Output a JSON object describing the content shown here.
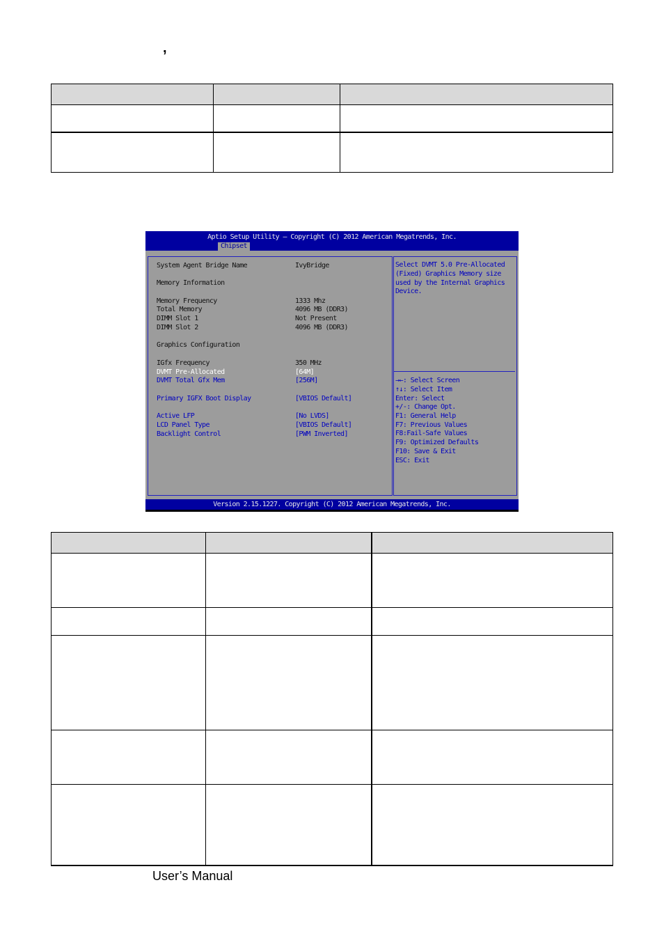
{
  "page": {
    "top_mark": ",",
    "footer": "User’s Manual"
  },
  "table_top": {
    "rows": 3,
    "columns": 3,
    "cells": [
      [
        "",
        "",
        ""
      ],
      [
        "",
        "",
        ""
      ],
      [
        "",
        "",
        ""
      ]
    ]
  },
  "table_bottom": {
    "rows": 6,
    "columns": 3,
    "cells": [
      [
        "",
        "",
        ""
      ],
      [
        "",
        "",
        ""
      ],
      [
        "",
        "",
        ""
      ],
      [
        "",
        "",
        ""
      ],
      [
        "",
        "",
        ""
      ],
      [
        "",
        "",
        ""
      ]
    ]
  },
  "bios": {
    "title": "Aptio Setup Utility – Copyright (C) 2012 American Megatrends, Inc.",
    "active_tab": "Chipset",
    "version": "Version 2.15.1227. Copyright (C) 2012 American Megatrends, Inc.",
    "colors": {
      "header_blue": "#0000a0",
      "panel_gray": "#9c9c9c",
      "link_blue": "#0000c0",
      "selected": "#ffffff"
    },
    "items": [
      {
        "label": "System Agent Bridge Name",
        "value": "IvyBridge",
        "type": "info"
      },
      {
        "label": "Memory Information",
        "value": "",
        "type": "heading"
      },
      {
        "label": "Memory Frequency",
        "value": "1333 Mhz",
        "type": "info"
      },
      {
        "label": "Total Memory",
        "value": "4096 MB (DDR3)",
        "type": "info"
      },
      {
        "label": "DIMM Slot 1",
        "value": "Not Present",
        "type": "info"
      },
      {
        "label": "DIMM Slot 2",
        "value": "4096 MB (DDR3)",
        "type": "info"
      },
      {
        "label": "Graphics Configuration",
        "value": "",
        "type": "heading"
      },
      {
        "label": "IGfx Frequency",
        "value": "350 MHz",
        "type": "info"
      },
      {
        "label": "DVMT Pre-Allocated",
        "value": "[64M]",
        "type": "option",
        "selected": true
      },
      {
        "label": "DVMT Total Gfx Mem",
        "value": "[256M]",
        "type": "option"
      },
      {
        "label": "Primary IGFX Boot Display",
        "value": "[VBIOS Default]",
        "type": "option"
      },
      {
        "label": "Active LFP",
        "value": "[No LVDS]",
        "type": "option"
      },
      {
        "label": "LCD Panel Type",
        "value": "[VBIOS Default]",
        "type": "option"
      },
      {
        "label": "Backlight Control",
        "value": "[PWM Inverted]",
        "type": "option"
      }
    ],
    "help_text": "Select DVMT 5.0 Pre-Allocated\n(Fixed) Graphics Memory size\nused by the Internal Graphics\nDevice.",
    "keys": [
      "→←: Select Screen",
      "↑↓: Select Item",
      "Enter: Select",
      "+/-: Change Opt.",
      "F1: General Help",
      "F7: Previous Values",
      "F8:Fail-Safe Values",
      "F9: Optimized Defaults",
      "F10: Save & Exit",
      "ESC: Exit"
    ]
  }
}
